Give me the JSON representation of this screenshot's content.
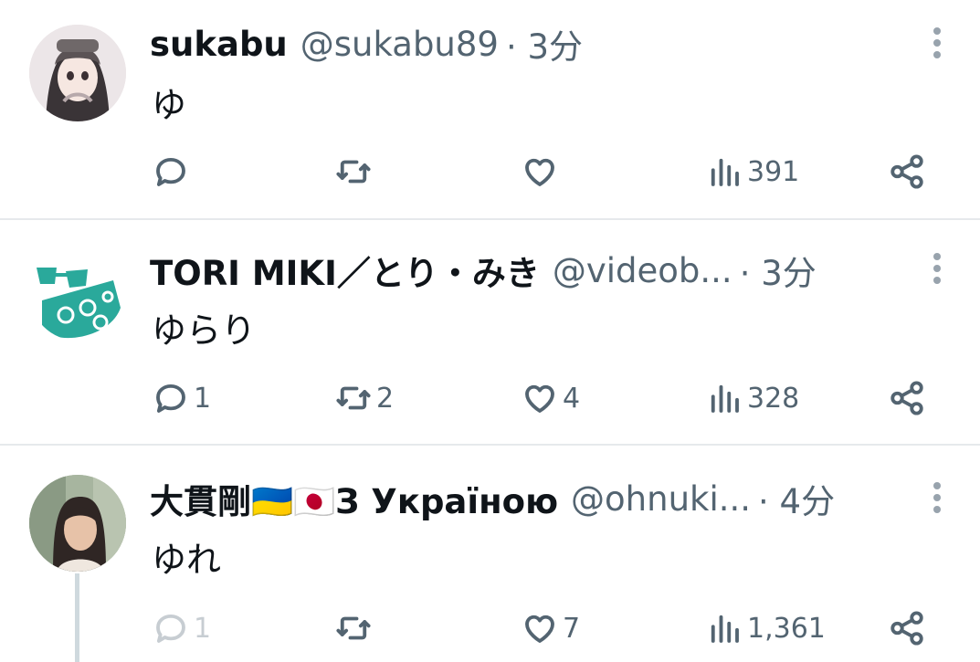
{
  "tweets": [
    {
      "name": "sukabu",
      "handle": "@sukabu89",
      "time": "· 3分",
      "text": "ゆ",
      "replies": "",
      "retweets": "",
      "likes": "",
      "views": "391"
    },
    {
      "name": "TORI MIKI／とり・みき",
      "handle": "@videob...",
      "time": "· 3分",
      "text": "ゆらり",
      "replies": "1",
      "retweets": "2",
      "likes": "4",
      "views": "328"
    },
    {
      "name": "大貫剛🇺🇦🇯🇵З Україною",
      "handle": "@ohnuki...",
      "time": "· 4分",
      "text": "ゆれ",
      "replies": "1",
      "retweets": "",
      "likes": "7",
      "views": "1,361"
    }
  ],
  "colors": {
    "text": "#0f1419",
    "secondary": "#536471",
    "divider": "#e6e9ec",
    "avatar2_teal": "#2aa99b"
  },
  "icons": [
    "reply-icon",
    "retweet-icon",
    "like-icon",
    "views-icon",
    "share-icon",
    "more-icon"
  ]
}
